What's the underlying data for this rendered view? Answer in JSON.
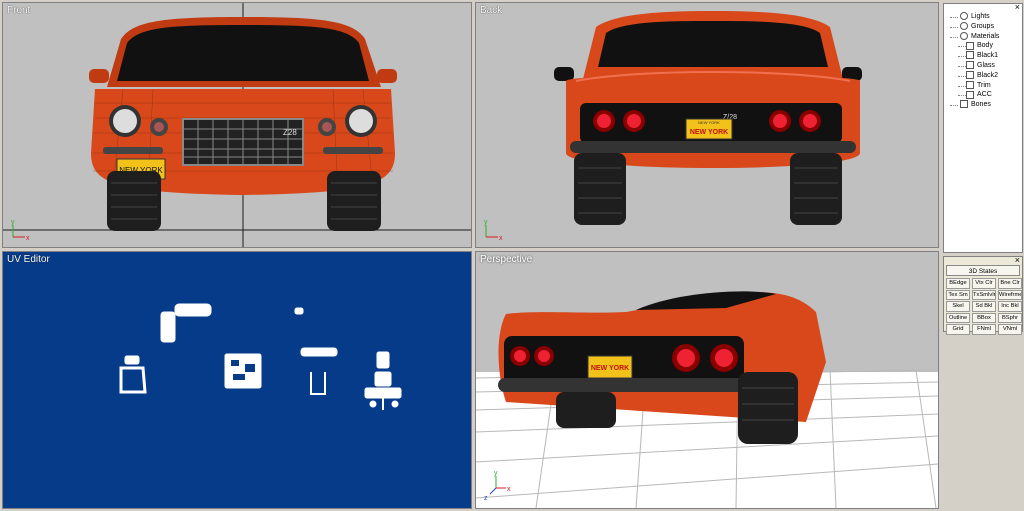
{
  "viewports": {
    "front": {
      "label": "Front",
      "plate_text": "NEW YORK",
      "badge": "Z28"
    },
    "back": {
      "label": "Back",
      "plate_text": "NEW YORK",
      "plate_top": "NEW YORK",
      "badge": "Z/28"
    },
    "uv": {
      "label": "UV Editor"
    },
    "perspective": {
      "label": "Perspective",
      "plate_text": "NEW YORK"
    }
  },
  "axes": {
    "y": "y",
    "x": "x",
    "z": "z"
  },
  "tree": {
    "items": [
      {
        "label": "Lights",
        "level": 0,
        "icon": "light-icon"
      },
      {
        "label": "Groups",
        "level": 0,
        "icon": "groups-icon"
      },
      {
        "label": "Materials",
        "level": 0,
        "icon": "materials-icon"
      },
      {
        "label": "Body",
        "level": 1,
        "icon": "material-icon"
      },
      {
        "label": "Black1",
        "level": 1,
        "icon": "material-icon"
      },
      {
        "label": "Glass",
        "level": 1,
        "icon": "material-icon"
      },
      {
        "label": "Black2",
        "level": 1,
        "icon": "material-icon"
      },
      {
        "label": "Trim",
        "level": 1,
        "icon": "material-icon"
      },
      {
        "label": "ACC",
        "level": 1,
        "icon": "material-icon"
      },
      {
        "label": "Bones",
        "level": 0,
        "icon": "bones-icon"
      }
    ]
  },
  "states_panel": {
    "title": "3D States",
    "buttons": [
      "BEdge",
      "Vtx Clr",
      "Bne Clr",
      "Tex Sm",
      "TxSmlvlr",
      "Wirefrme",
      "Skel",
      "Sd Bkl",
      "Inc Bkl",
      "Outline",
      "BBox",
      "BSphr",
      "Grid",
      "FNml",
      "VNml"
    ]
  },
  "colors": {
    "body": "#d8481a",
    "uv_bg": "#063b8a",
    "viewport_bg": "#c0c0c0",
    "plate": "#f2c21a"
  }
}
